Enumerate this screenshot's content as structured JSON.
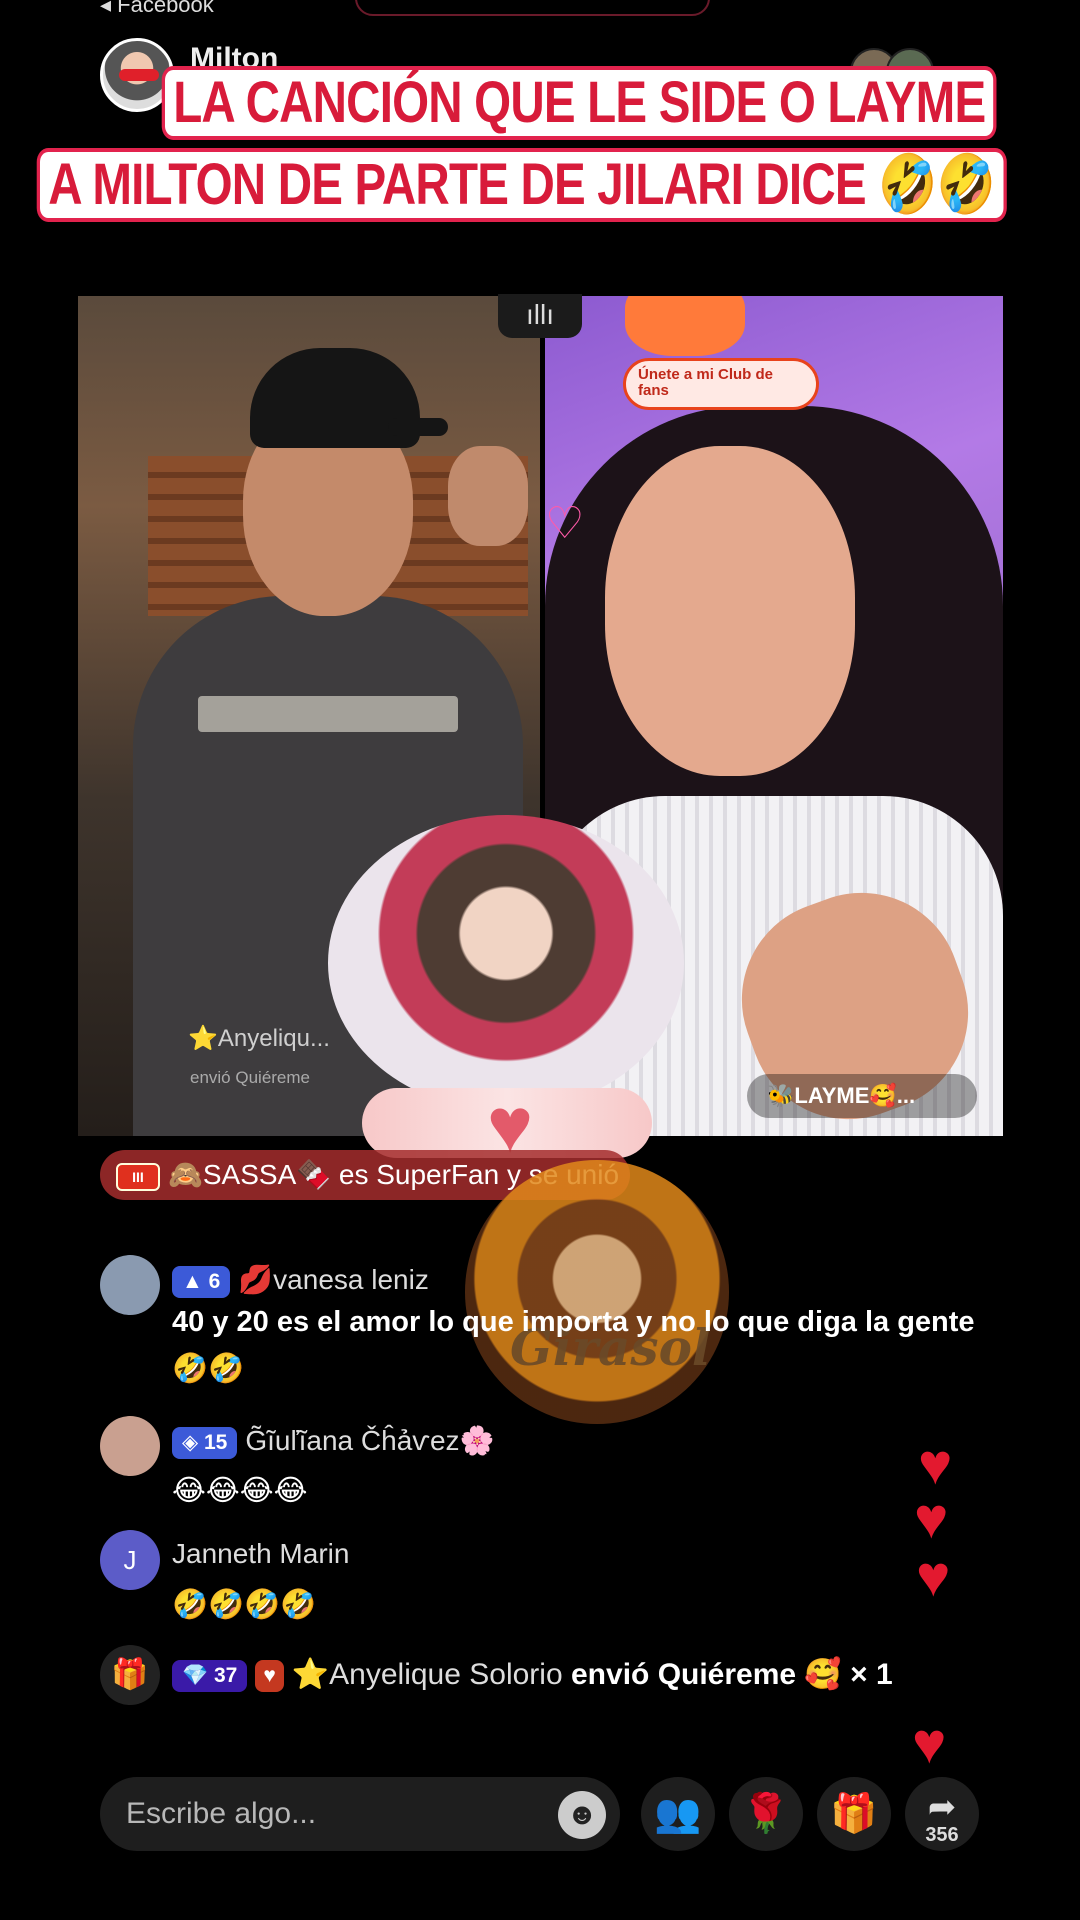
{
  "header": {
    "back_label": "◂ Facebook",
    "host_name": "Milton"
  },
  "caption": {
    "line1": "La canción que le side o Layme",
    "line2": "A Milton de parte de Jilari dice 🤣🤣"
  },
  "video_left": {
    "gift_user": "⭐Anyeliqu...",
    "gift_text": "envió Quiéreme"
  },
  "video_right": {
    "club_badge": "Únete a mi Club de fans",
    "name_pill": "🐝LAYME🥰..."
  },
  "divider_icon": "audio-bars-icon",
  "superfan_banner": {
    "badge": "III",
    "text": "🙈SASSA🍫 es SuperFan y se unió"
  },
  "sticker_word": "Girasol",
  "comments": [
    {
      "level": "6",
      "name": "💋vanesa leniz",
      "text": "40 y 20 es el amor lo que importa y no lo que diga la gente 🤣🤣"
    },
    {
      "level": "15",
      "name": "G̃ĩuľĩanа Čĥảѵez🌸",
      "text": "😂😂😂😂"
    },
    {
      "avatar_letter": "J",
      "name": "Janneth Marin",
      "text": "🤣🤣🤣🤣"
    },
    {
      "level": "37",
      "name": "⭐Anyelique Solorio",
      "text": "envió Quiéreme 🥰 × 1"
    }
  ],
  "input": {
    "placeholder": "Escribe algo..."
  },
  "actions": {
    "share_count": "356"
  },
  "colors": {
    "caption_text": "#d81b3a",
    "caption_outline": "#e2234d",
    "heart": "#e3192f",
    "level_badge": "#3c5ad8"
  }
}
